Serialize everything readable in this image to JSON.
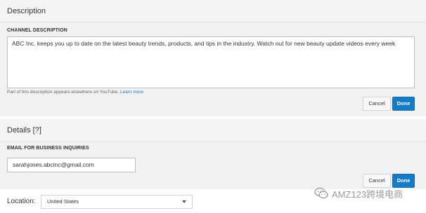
{
  "description_section": {
    "heading": "Description",
    "field_label": "CHANNEL DESCRIPTION",
    "value": "ABC Inc. keeps you up to date on the latest beauty trends, products, and tips in the industry. Watch out for new beauty update videos every week",
    "note": "Part of this description appears elsewhere on YouTube.",
    "note_link": "Learn more",
    "cancel_label": "Cancel",
    "done_label": "Done"
  },
  "details_section": {
    "heading": "Details [?]",
    "field_label": "EMAIL FOR BUSINESS INQUIRIES",
    "email_value": "sarahjones.abcinc@gmail.com",
    "cancel_label": "Cancel",
    "done_label": "Done"
  },
  "location": {
    "label": "Location:",
    "selected": "United States"
  },
  "watermark": {
    "text": "AMZ123跨境电商",
    "icon": "wechat-icon"
  },
  "colors": {
    "primary_button": "#167ac6",
    "link": "#167ac6",
    "panel_background": "#f1f1f1"
  }
}
